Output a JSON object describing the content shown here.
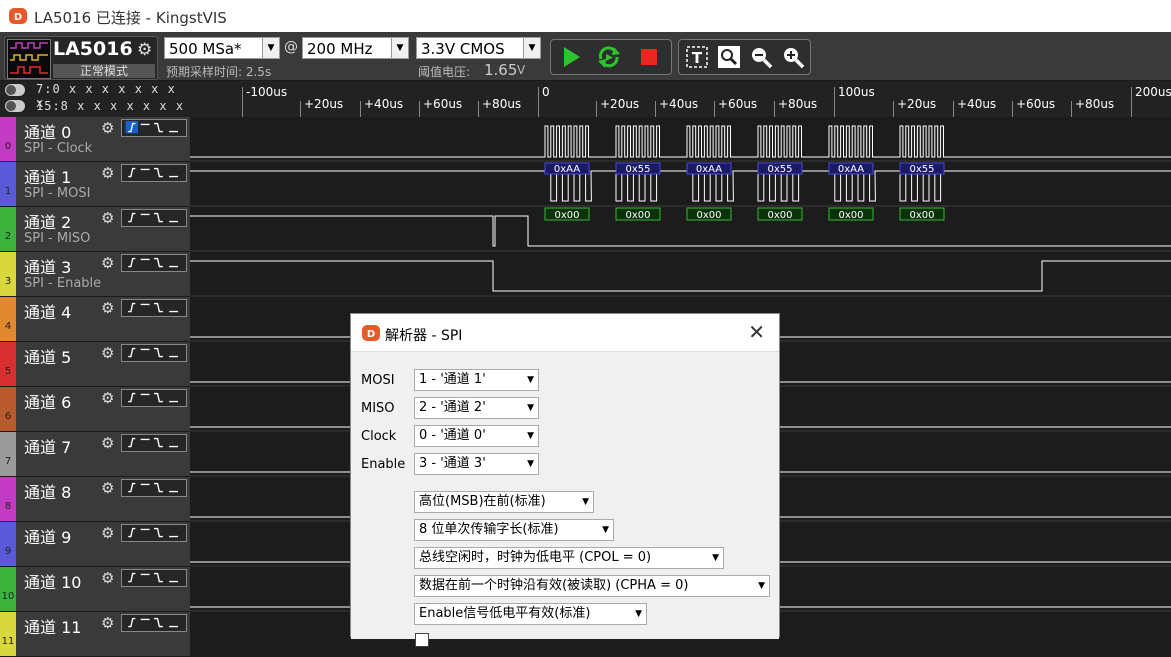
{
  "window": {
    "title": "LA5016 已连接 - KingstVIS"
  },
  "device": {
    "name": "LA5016",
    "status": "正常模式"
  },
  "toolbar": {
    "sample_rate": "500 MSa*",
    "at": "@",
    "sample_depth": "200 MHz",
    "voltage": "3.3V CMOS",
    "est_time_label": "预期采样时间: 2.5s",
    "threshold_label": "阈值电压:",
    "threshold_value": "1.65",
    "threshold_unit": "V"
  },
  "ruler_left": {
    "row1": "7:0  x x x x x x x x",
    "row2": "15:8  x x x x x x x x"
  },
  "channels": [
    {
      "name": "通道 0",
      "sub": "SPI - Clock",
      "num": "0",
      "color": "#c23bc2"
    },
    {
      "name": "通道 1",
      "sub": "SPI - MOSI",
      "num": "1",
      "color": "#5a5ad8"
    },
    {
      "name": "通道 2",
      "sub": "SPI - MISO",
      "num": "2",
      "color": "#3cb33c"
    },
    {
      "name": "通道 3",
      "sub": "SPI - Enable",
      "num": "3",
      "color": "#d8d83c"
    },
    {
      "name": "通道 4",
      "sub": "",
      "num": "4",
      "color": "#e0892e"
    },
    {
      "name": "通道 5",
      "sub": "",
      "num": "5",
      "color": "#d83030"
    },
    {
      "name": "通道 6",
      "sub": "",
      "num": "6",
      "color": "#b85a2e"
    },
    {
      "name": "通道 7",
      "sub": "",
      "num": "7",
      "color": "#9a9a9a"
    },
    {
      "name": "通道 8",
      "sub": "",
      "num": "8",
      "color": "#c23bc2"
    },
    {
      "name": "通道 9",
      "sub": "",
      "num": "9",
      "color": "#5a5ad8"
    },
    {
      "name": "通道 10",
      "sub": "",
      "num": "10",
      "color": "#3cb33c"
    },
    {
      "name": "通道 11",
      "sub": "",
      "num": "11",
      "color": "#d8d83c"
    }
  ],
  "ruler": {
    "ticks": [
      "-100us",
      "+20us",
      "+40us",
      "+60us",
      "+80us",
      "0",
      "+20us",
      "+40us",
      "+60us",
      "+80us",
      "100us",
      "+20us",
      "+40us",
      "+60us",
      "+80us",
      "200us"
    ]
  },
  "decode": {
    "mosi": [
      "0xAA",
      "0x55",
      "0xAA",
      "0x55",
      "0xAA",
      "0x55"
    ],
    "miso": [
      "0x00",
      "0x00",
      "0x00",
      "0x00",
      "0x00",
      "0x00"
    ]
  },
  "dialog": {
    "title": "解析器 - SPI",
    "close": "✕",
    "mosi_label": "MOSI",
    "mosi_value": "1 - '通道 1'",
    "miso_label": "MISO",
    "miso_value": "2 - '通道 2'",
    "clock_label": "Clock",
    "clock_value": "0 - '通道 0'",
    "enable_label": "Enable",
    "enable_value": "3 - '通道 3'",
    "bit_order": "高位(MSB)在前(标准)",
    "bits": "8 位单次传输字长(标准)",
    "cpol": "总线空闲时，时钟为低电平 (CPOL = 0)",
    "cpha": "数据在前一个时钟沿有效(被读取) (CPHA = 0)",
    "enable_active": "Enable信号低电平有效(标准)"
  }
}
